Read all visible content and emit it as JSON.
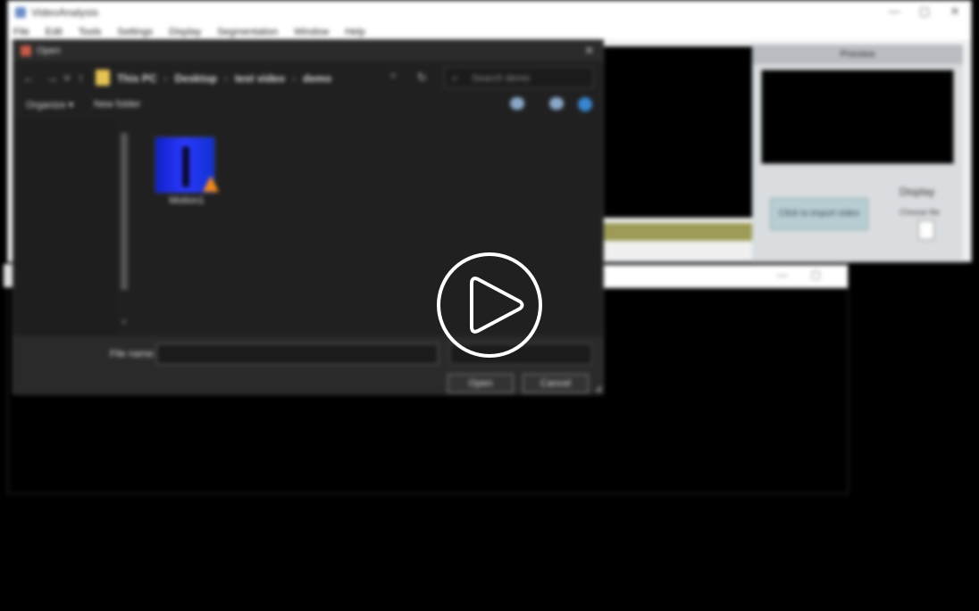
{
  "app": {
    "title": "VideoAnalysis",
    "menu": [
      "File",
      "Edit",
      "Tools",
      "Settings",
      "Display",
      "Segmentation",
      "Window",
      "Help"
    ],
    "window_buttons": [
      "—",
      "▢",
      "✕"
    ],
    "panel": {
      "header": "Preview",
      "button_label": "Click to import video",
      "display_label": "Display",
      "display_sub": "Choose file"
    },
    "seekbar_color": "#9d9b57"
  },
  "dialog": {
    "title": "Open",
    "close": "✕",
    "nav": {
      "back": "←",
      "forward": "→",
      "up": "↑",
      "recent": "˅"
    },
    "breadcrumbs": [
      "This PC",
      "Desktop",
      "test video",
      "demo"
    ],
    "breadcrumb_sep": "›",
    "address_dropdown": "˅",
    "refresh": "↻",
    "search_placeholder": "Search demo",
    "organize": "Organize ▾",
    "new_folder": "New folder",
    "file": {
      "name": "Motion1",
      "thumb_color": "#1a2ff0",
      "overlay_icon": "vlc-cone-icon"
    },
    "file_name_label": "File name:",
    "file_name_value": "",
    "filter": "",
    "open_button": "Open",
    "cancel_button": "Cancel"
  },
  "overlay": {
    "icon": "play-icon"
  }
}
